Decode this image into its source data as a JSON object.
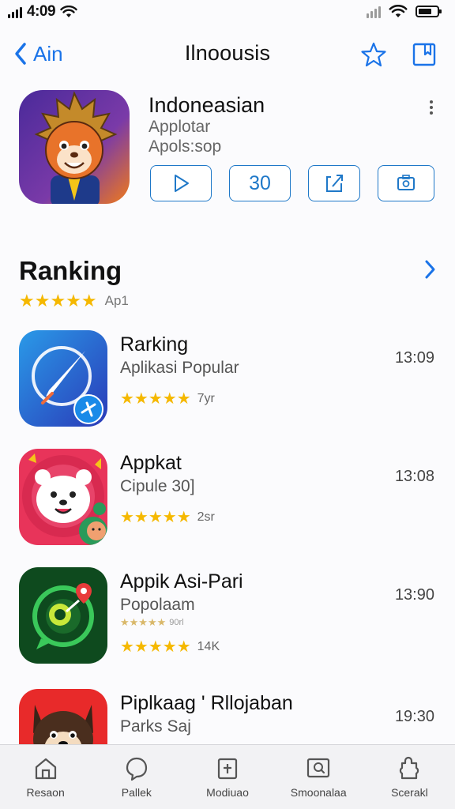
{
  "status_bar": {
    "time": "4:09"
  },
  "nav": {
    "back_label": "Ain",
    "title": "Ilnoousis",
    "icons": [
      "star-icon",
      "bookmark-icon"
    ]
  },
  "app": {
    "name": "Indoneasian",
    "subtitle1": "Applotar",
    "subtitle2": "Apols:sop",
    "actions": [
      {
        "icon": "play-icon",
        "label": ""
      },
      {
        "icon": "",
        "label": "30"
      },
      {
        "icon": "share-icon",
        "label": ""
      },
      {
        "icon": "camera-icon",
        "label": ""
      }
    ]
  },
  "section": {
    "title": "Ranking",
    "stars": 5,
    "rating_count": "Ap1"
  },
  "items": [
    {
      "title": "Rarking",
      "subtitle": "Aplikasi Popular",
      "stars": 5,
      "rating_count": "7yr",
      "time": "13:09",
      "icon": "compass-app-icon"
    },
    {
      "title": "Appkat",
      "subtitle": "Cipule 30]",
      "stars": 5,
      "rating_count": "2sr",
      "time": "13:08",
      "icon": "bear-app-icon"
    },
    {
      "title": "Appik Asi-Pari",
      "subtitle": "Popolaam",
      "small_stars": 5,
      "small_rating_count": "90rl",
      "stars": 5,
      "rating_count": "14K",
      "time": "13:90",
      "icon": "chat-app-icon"
    },
    {
      "title": "Piplkaag ' Rllojaban",
      "subtitle": "Parks Saj",
      "time": "19:30",
      "icon": "dog-app-icon"
    }
  ],
  "tabs": [
    {
      "label": "Resaon",
      "icon": "home-icon"
    },
    {
      "label": "Pallek",
      "icon": "bubble-icon"
    },
    {
      "label": "Modiuao",
      "icon": "doc-icon"
    },
    {
      "label": "Smoonalaa",
      "icon": "search-box-icon"
    },
    {
      "label": "Scerakl",
      "icon": "puzzle-icon"
    }
  ],
  "colors": {
    "accent": "#1a73e8",
    "star": "#f5b800",
    "background": "#fbfbfd"
  }
}
